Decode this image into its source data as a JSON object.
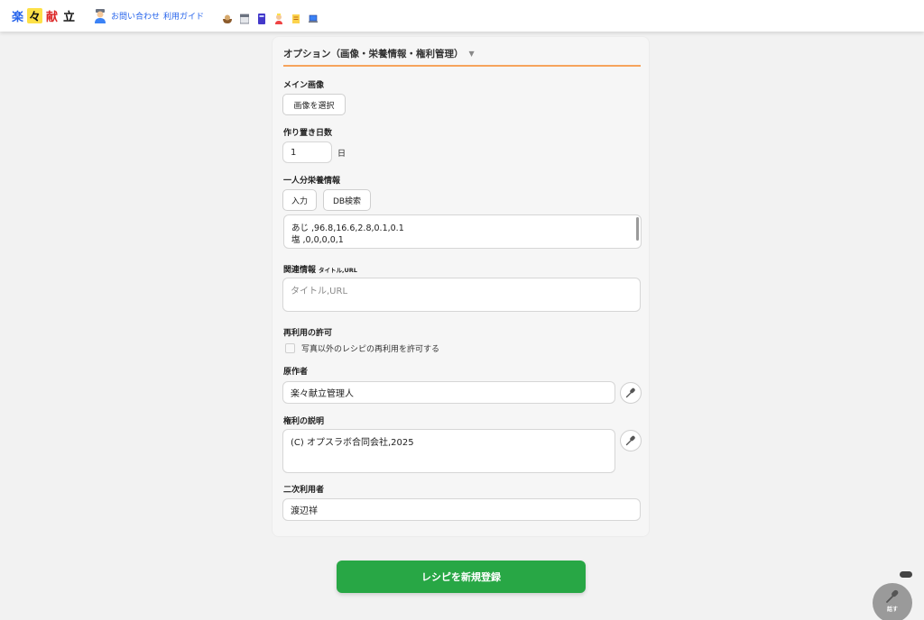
{
  "header": {
    "logo": [
      "楽",
      "々",
      "献",
      "立"
    ],
    "links": [
      "お問い合わせ",
      "利用ガイド"
    ],
    "tool_icons": [
      "bowl-icon",
      "calendar-icon",
      "book-icon",
      "chef-icon",
      "scroll-icon",
      "laptop-icon"
    ]
  },
  "options": {
    "title": "オプション（画像・栄養情報・権利管理）",
    "toggle": "▼",
    "main_image": {
      "label": "メイン画像",
      "button": "画像を選択"
    },
    "keep_days": {
      "label": "作り置き日数",
      "value": "1",
      "unit": "日"
    },
    "nutrition": {
      "label": "一人分栄養情報",
      "input_button": "入力",
      "db_button": "DB検索",
      "lines": [
        "あじ ,96.8,16.6,2.8,0.1,0.1",
        "塩 ,0,0,0,0,1"
      ]
    },
    "related": {
      "label": "関連情報",
      "hint": "タイトル,URL",
      "placeholder": "タイトル,URL"
    },
    "reuse": {
      "label": "再利用の許可",
      "checkbox_label": "写真以外のレシピの再利用を許可する",
      "checked": false
    },
    "author": {
      "label": "原作者",
      "value": "楽々献立管理人"
    },
    "rights": {
      "label": "権利の説明",
      "value": "(C) オプスラボ合同会社,2025"
    },
    "secondary": {
      "label": "二次利用者",
      "value": "渡辺祥"
    }
  },
  "submit": {
    "label": "レシピを新規登録"
  },
  "voice_fab": {
    "label": "話す"
  },
  "colors": {
    "accent": "#f6a35c",
    "submit": "#28a745",
    "link": "#2563eb"
  }
}
